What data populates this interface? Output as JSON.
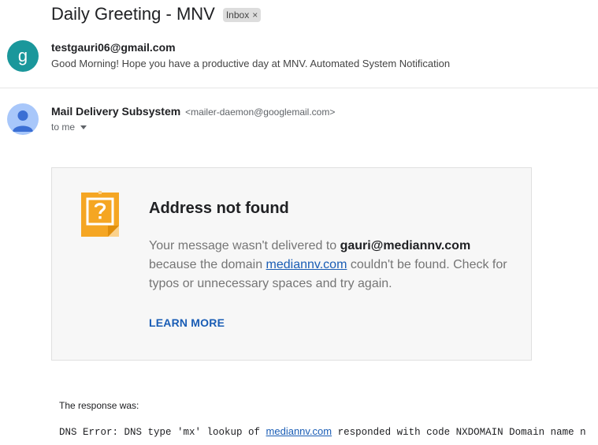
{
  "thread": {
    "subject": "Daily Greeting - MNV",
    "label": "Inbox",
    "label_remove": "×"
  },
  "message1": {
    "avatar_letter": "g",
    "sender": "testgauri06@gmail.com",
    "snippet": "Good Morning! Hope you have a productive day at MNV. Automated System Notification"
  },
  "message2": {
    "sender_name": "Mail Delivery Subsystem",
    "sender_email": "<mailer-daemon@googlemail.com>",
    "recipient": "to me"
  },
  "bounce": {
    "icon": "question-note-icon",
    "title": "Address not found",
    "body_1": "Your message wasn't delivered to ",
    "address": "gauri@mediannv.com",
    "body_2": " because the domain ",
    "domain": "mediannv.com",
    "body_3": " couldn't be found. Check for typos or unnecessary spaces and try again.",
    "learn_more": "LEARN MORE"
  },
  "response": {
    "label": "The response was:",
    "dns_prefix": "DNS Error: DNS type 'mx' lookup of ",
    "dns_domain": "mediannv.com",
    "dns_suffix": " responded with code NXDOMAIN Domain name n"
  },
  "colors": {
    "avatar_g": "#1a979b",
    "avatar_person": "#a8c7fa",
    "link": "#1a5db5",
    "note_icon": "#f5a623"
  }
}
